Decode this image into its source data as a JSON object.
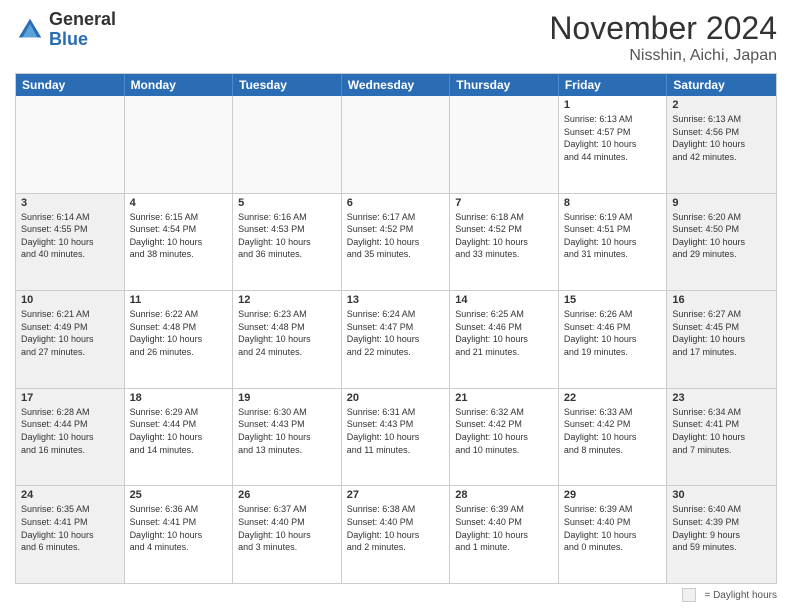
{
  "logo": {
    "general": "General",
    "blue": "Blue"
  },
  "header": {
    "title": "November 2024",
    "subtitle": "Nisshin, Aichi, Japan"
  },
  "days_of_week": [
    "Sunday",
    "Monday",
    "Tuesday",
    "Wednesday",
    "Thursday",
    "Friday",
    "Saturday"
  ],
  "legend": {
    "box_label": "= Daylight hours"
  },
  "weeks": [
    [
      {
        "day": "",
        "info": ""
      },
      {
        "day": "",
        "info": ""
      },
      {
        "day": "",
        "info": ""
      },
      {
        "day": "",
        "info": ""
      },
      {
        "day": "",
        "info": ""
      },
      {
        "day": "1",
        "info": "Sunrise: 6:13 AM\nSunset: 4:57 PM\nDaylight: 10 hours\nand 44 minutes."
      },
      {
        "day": "2",
        "info": "Sunrise: 6:13 AM\nSunset: 4:56 PM\nDaylight: 10 hours\nand 42 minutes."
      }
    ],
    [
      {
        "day": "3",
        "info": "Sunrise: 6:14 AM\nSunset: 4:55 PM\nDaylight: 10 hours\nand 40 minutes."
      },
      {
        "day": "4",
        "info": "Sunrise: 6:15 AM\nSunset: 4:54 PM\nDaylight: 10 hours\nand 38 minutes."
      },
      {
        "day": "5",
        "info": "Sunrise: 6:16 AM\nSunset: 4:53 PM\nDaylight: 10 hours\nand 36 minutes."
      },
      {
        "day": "6",
        "info": "Sunrise: 6:17 AM\nSunset: 4:52 PM\nDaylight: 10 hours\nand 35 minutes."
      },
      {
        "day": "7",
        "info": "Sunrise: 6:18 AM\nSunset: 4:52 PM\nDaylight: 10 hours\nand 33 minutes."
      },
      {
        "day": "8",
        "info": "Sunrise: 6:19 AM\nSunset: 4:51 PM\nDaylight: 10 hours\nand 31 minutes."
      },
      {
        "day": "9",
        "info": "Sunrise: 6:20 AM\nSunset: 4:50 PM\nDaylight: 10 hours\nand 29 minutes."
      }
    ],
    [
      {
        "day": "10",
        "info": "Sunrise: 6:21 AM\nSunset: 4:49 PM\nDaylight: 10 hours\nand 27 minutes."
      },
      {
        "day": "11",
        "info": "Sunrise: 6:22 AM\nSunset: 4:48 PM\nDaylight: 10 hours\nand 26 minutes."
      },
      {
        "day": "12",
        "info": "Sunrise: 6:23 AM\nSunset: 4:48 PM\nDaylight: 10 hours\nand 24 minutes."
      },
      {
        "day": "13",
        "info": "Sunrise: 6:24 AM\nSunset: 4:47 PM\nDaylight: 10 hours\nand 22 minutes."
      },
      {
        "day": "14",
        "info": "Sunrise: 6:25 AM\nSunset: 4:46 PM\nDaylight: 10 hours\nand 21 minutes."
      },
      {
        "day": "15",
        "info": "Sunrise: 6:26 AM\nSunset: 4:46 PM\nDaylight: 10 hours\nand 19 minutes."
      },
      {
        "day": "16",
        "info": "Sunrise: 6:27 AM\nSunset: 4:45 PM\nDaylight: 10 hours\nand 17 minutes."
      }
    ],
    [
      {
        "day": "17",
        "info": "Sunrise: 6:28 AM\nSunset: 4:44 PM\nDaylight: 10 hours\nand 16 minutes."
      },
      {
        "day": "18",
        "info": "Sunrise: 6:29 AM\nSunset: 4:44 PM\nDaylight: 10 hours\nand 14 minutes."
      },
      {
        "day": "19",
        "info": "Sunrise: 6:30 AM\nSunset: 4:43 PM\nDaylight: 10 hours\nand 13 minutes."
      },
      {
        "day": "20",
        "info": "Sunrise: 6:31 AM\nSunset: 4:43 PM\nDaylight: 10 hours\nand 11 minutes."
      },
      {
        "day": "21",
        "info": "Sunrise: 6:32 AM\nSunset: 4:42 PM\nDaylight: 10 hours\nand 10 minutes."
      },
      {
        "day": "22",
        "info": "Sunrise: 6:33 AM\nSunset: 4:42 PM\nDaylight: 10 hours\nand 8 minutes."
      },
      {
        "day": "23",
        "info": "Sunrise: 6:34 AM\nSunset: 4:41 PM\nDaylight: 10 hours\nand 7 minutes."
      }
    ],
    [
      {
        "day": "24",
        "info": "Sunrise: 6:35 AM\nSunset: 4:41 PM\nDaylight: 10 hours\nand 6 minutes."
      },
      {
        "day": "25",
        "info": "Sunrise: 6:36 AM\nSunset: 4:41 PM\nDaylight: 10 hours\nand 4 minutes."
      },
      {
        "day": "26",
        "info": "Sunrise: 6:37 AM\nSunset: 4:40 PM\nDaylight: 10 hours\nand 3 minutes."
      },
      {
        "day": "27",
        "info": "Sunrise: 6:38 AM\nSunset: 4:40 PM\nDaylight: 10 hours\nand 2 minutes."
      },
      {
        "day": "28",
        "info": "Sunrise: 6:39 AM\nSunset: 4:40 PM\nDaylight: 10 hours\nand 1 minute."
      },
      {
        "day": "29",
        "info": "Sunrise: 6:39 AM\nSunset: 4:40 PM\nDaylight: 10 hours\nand 0 minutes."
      },
      {
        "day": "30",
        "info": "Sunrise: 6:40 AM\nSunset: 4:39 PM\nDaylight: 9 hours\nand 59 minutes."
      }
    ]
  ]
}
